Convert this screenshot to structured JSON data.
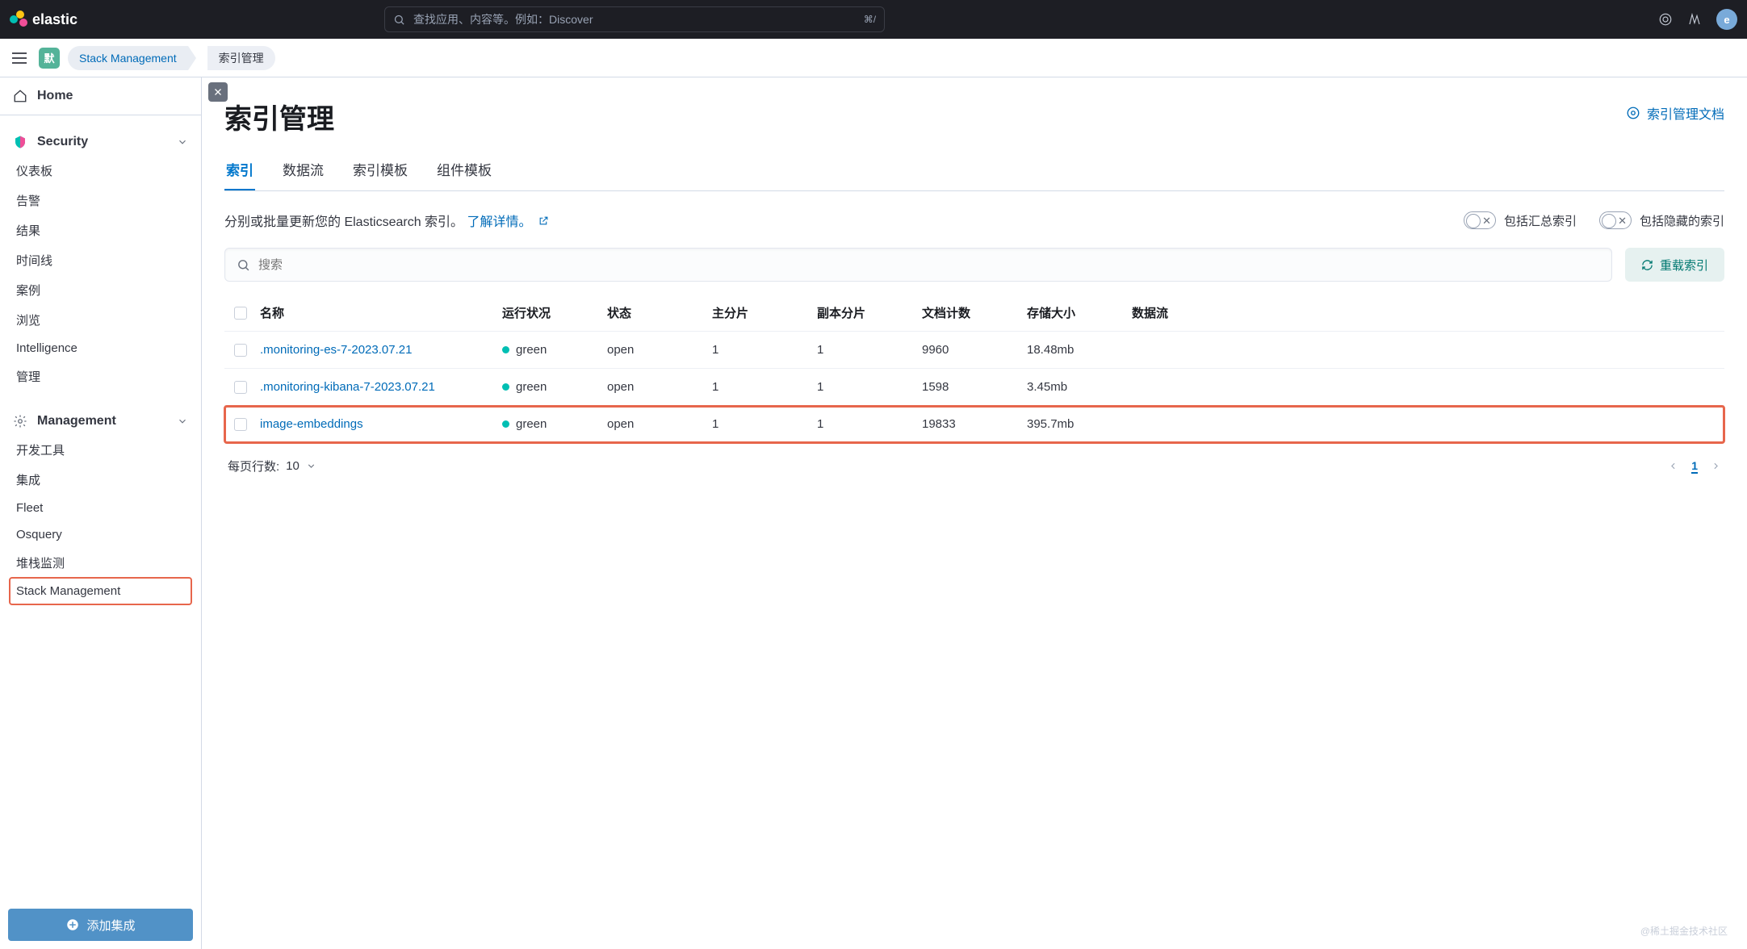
{
  "brand": "elastic",
  "top_search_placeholder": "查找应用、内容等。例如：Discover",
  "keyboard_shortcut": "⌘/",
  "avatar_letter": "e",
  "space_badge": "默",
  "breadcrumbs": {
    "stack_management": "Stack Management",
    "current": "索引管理"
  },
  "sidebar": {
    "home": "Home",
    "security_header": "Security",
    "security_items": [
      "仪表板",
      "告警",
      "结果",
      "时间线",
      "案例",
      "浏览",
      "Intelligence",
      "管理"
    ],
    "management_header": "Management",
    "management_items": [
      "开发工具",
      "集成",
      "Fleet",
      "Osquery",
      "堆栈监测",
      "Stack Management"
    ],
    "add_integration": "添加集成"
  },
  "page": {
    "title": "索引管理",
    "docs_link": "索引管理文档",
    "tabs": [
      "索引",
      "数据流",
      "索引模板",
      "组件模板"
    ],
    "description": "分别或批量更新您的 Elasticsearch 索引。",
    "learn_more": "了解详情。",
    "toggle_rollup": "包括汇总索引",
    "toggle_hidden": "包括隐藏的索引",
    "search_placeholder": "搜索",
    "reload_label": "重载索引",
    "columns": {
      "name": "名称",
      "health": "运行状况",
      "status": "状态",
      "primaries": "主分片",
      "replicas": "副本分片",
      "docs": "文档计数",
      "storage": "存储大小",
      "data_stream": "数据流"
    },
    "rows": [
      {
        "name": ".monitoring-es-7-2023.07.21",
        "health": "green",
        "status": "open",
        "primaries": "1",
        "replicas": "1",
        "docs": "9960",
        "storage": "18.48mb",
        "highlighted": false
      },
      {
        "name": ".monitoring-kibana-7-2023.07.21",
        "health": "green",
        "status": "open",
        "primaries": "1",
        "replicas": "1",
        "docs": "1598",
        "storage": "3.45mb",
        "highlighted": false
      },
      {
        "name": "image-embeddings",
        "health": "green",
        "status": "open",
        "primaries": "1",
        "replicas": "1",
        "docs": "19833",
        "storage": "395.7mb",
        "highlighted": true
      }
    ],
    "rows_per_page_label": "每页行数:",
    "rows_per_page_value": "10",
    "current_page": "1",
    "watermark": "@稀土掘金技术社区"
  }
}
